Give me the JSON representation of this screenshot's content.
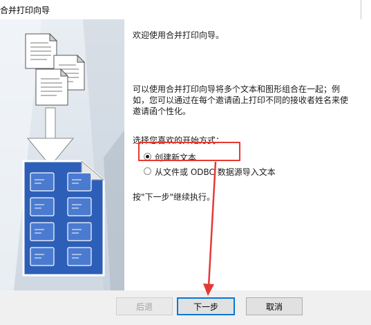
{
  "window": {
    "title": "合并打印向导"
  },
  "intro": {
    "welcome": "欢迎使用合并打印向导。",
    "desc_line1": "可以使用合并打印向导将多个文本和图形组合在一起；例",
    "desc_line2": "如，您可以通过在每个邀请函上打印不同的接收者姓名来使",
    "desc_line3": "邀请函个性化。"
  },
  "start_options": {
    "prompt": "选择您喜欢的开始方式：",
    "option_new": "创建新文本",
    "option_import": "从文件或 ODBC 数据源导入文本",
    "selected": "创建新文本"
  },
  "hint": "按\"下一步\"继续执行。",
  "buttons": {
    "back": "后退",
    "next": "下一步",
    "cancel": "取消"
  },
  "colors": {
    "annotation": "#e53935",
    "accent": "#0078d7",
    "document_blue": "#2e5fb8"
  }
}
